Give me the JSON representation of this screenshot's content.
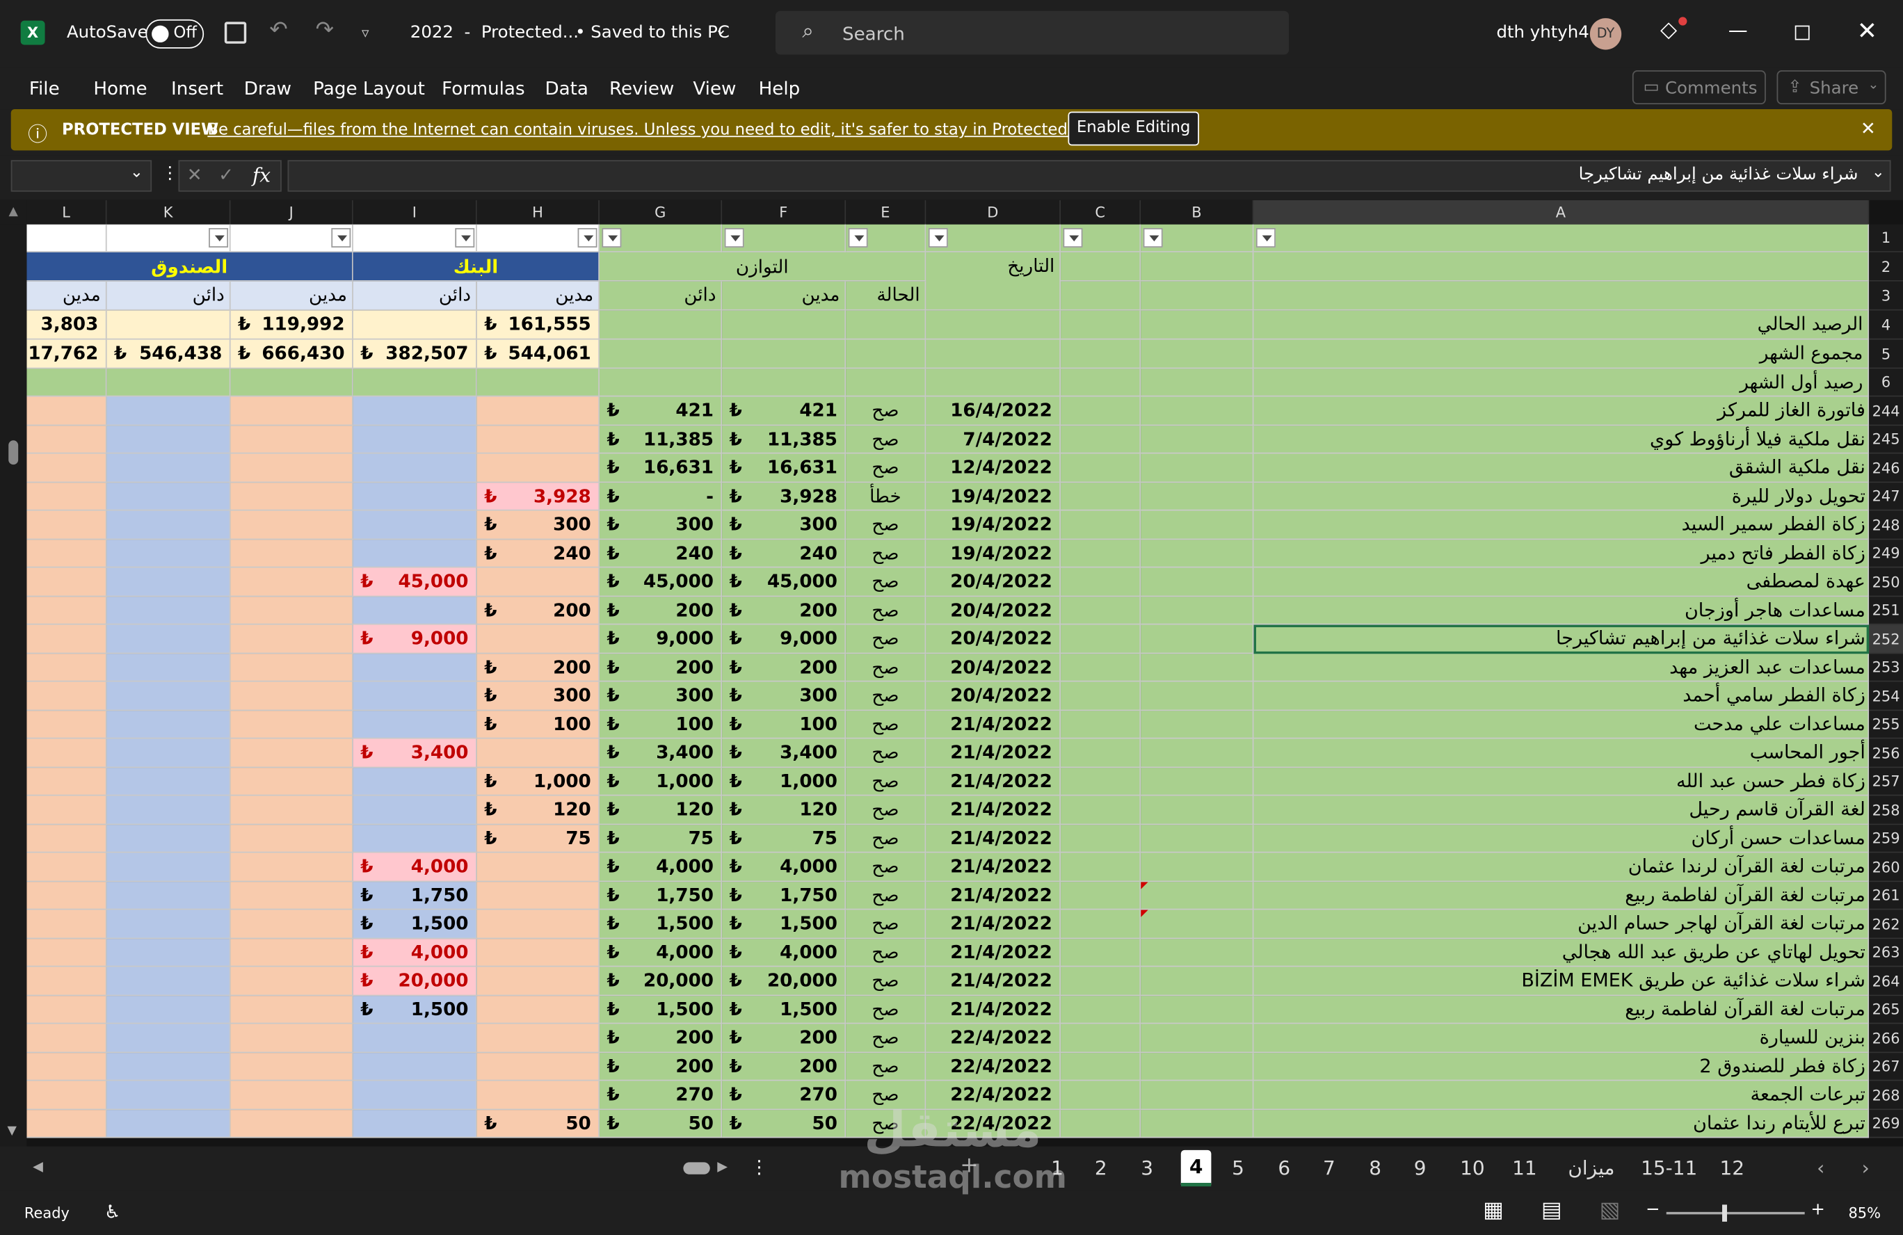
{
  "titlebar": {
    "autosave_label": "AutoSave",
    "toggle_label": "Off",
    "file_name": "2022  -  Protected...",
    "saved_status": "• Saved to this PC",
    "search_placeholder": "Search",
    "user_name": "dth yhtyh4",
    "avatar_initials": "DY"
  },
  "menu": [
    "File",
    "Home",
    "Insert",
    "Draw",
    "Page Layout",
    "Formulas",
    "Data",
    "Review",
    "View",
    "Help"
  ],
  "comments_label": "Comments",
  "share_label": "Share",
  "protected": {
    "title": "PROTECTED VIEW",
    "message": "Be careful—files from the Internet can contain viruses. Unless you need to edit, it's safer to stay in Protected View.",
    "button": "Enable Editing"
  },
  "formula": {
    "fx": "fx",
    "content": "شراء سلات غذائية من إبراهيم تشاكيرجا"
  },
  "columns": [
    "L",
    "K",
    "J",
    "I",
    "H",
    "G",
    "F",
    "E",
    "D",
    "C",
    "B",
    "A"
  ],
  "headers": {
    "bank": "البنك",
    "cash": "الصندوق",
    "balance": "التوازن",
    "date": "التاريخ",
    "status": "الحالة",
    "debit": "مدين",
    "credit": "دائن"
  },
  "summary": {
    "labels": [
      "الرصيد الحالي",
      "مجموع الشهر",
      "رصيد أول الشهر"
    ],
    "row4": {
      "L": "3,803",
      "J": "119,992",
      "H": "161,555"
    },
    "row5": {
      "L": "17,762",
      "K": "546,438",
      "J": "666,430",
      "I": "382,507",
      "H": "544,061"
    }
  },
  "currency": "₺",
  "rows": [
    {
      "n": "244",
      "a": "فاتورة الغاز للمركز",
      "d": "16/4/2022",
      "e": "صح",
      "f": "421",
      "g": "421"
    },
    {
      "n": "245",
      "a": "نقل ملكية فيلا أرناؤوط كوي",
      "d": "7/4/2022",
      "e": "صح",
      "f": "11,385",
      "g": "11,385"
    },
    {
      "n": "246",
      "a": "نقل ملكية الشقق",
      "d": "12/4/2022",
      "e": "صح",
      "f": "16,631",
      "g": "16,631"
    },
    {
      "n": "247",
      "a": "تحويل دولار لليرة",
      "d": "19/4/2022",
      "e": "خطأ",
      "f": "3,928",
      "g": "-",
      "h": "3,928",
      "hred": true
    },
    {
      "n": "248",
      "a": "زكاة الفطر  سمير السيد",
      "d": "19/4/2022",
      "e": "صح",
      "f": "300",
      "g": "300",
      "h": "300"
    },
    {
      "n": "249",
      "a": "زكاة الفطر فاتح دمير",
      "d": "19/4/2022",
      "e": "صح",
      "f": "240",
      "g": "240",
      "h": "240"
    },
    {
      "n": "250",
      "a": "عهدة لمصطفى",
      "d": "20/4/2022",
      "e": "صح",
      "f": "45,000",
      "g": "45,000",
      "i": "45,000",
      "ired": true
    },
    {
      "n": "251",
      "a": "مساعدات هاجر أوزجان",
      "d": "20/4/2022",
      "e": "صح",
      "f": "200",
      "g": "200",
      "h": "200"
    },
    {
      "n": "252",
      "a": "شراء سلات غذائية من إبراهيم تشاكيرجا",
      "d": "20/4/2022",
      "e": "صح",
      "f": "9,000",
      "g": "9,000",
      "i": "9,000",
      "ired": true
    },
    {
      "n": "253",
      "a": "مساعدات عبد العزيز مهد",
      "d": "20/4/2022",
      "e": "صح",
      "f": "200",
      "g": "200",
      "h": "200"
    },
    {
      "n": "254",
      "a": "زكاة الفطر سامي أحمد",
      "d": "20/4/2022",
      "e": "صح",
      "f": "300",
      "g": "300",
      "h": "300"
    },
    {
      "n": "255",
      "a": "مساعدات علي مدحت",
      "d": "21/4/2022",
      "e": "صح",
      "f": "100",
      "g": "100",
      "h": "100"
    },
    {
      "n": "256",
      "a": "أجور المحاسب",
      "d": "21/4/2022",
      "e": "صح",
      "f": "3,400",
      "g": "3,400",
      "i": "3,400",
      "ired": true
    },
    {
      "n": "257",
      "a": "زكاة فطر حسن عبد الله",
      "d": "21/4/2022",
      "e": "صح",
      "f": "1,000",
      "g": "1,000",
      "h": "1,000"
    },
    {
      "n": "258",
      "a": "لغة القرآن قاسم رحيل",
      "d": "21/4/2022",
      "e": "صح",
      "f": "120",
      "g": "120",
      "h": "120"
    },
    {
      "n": "259",
      "a": "مساعدات حسن أركان",
      "d": "21/4/2022",
      "e": "صح",
      "f": "75",
      "g": "75",
      "h": "75"
    },
    {
      "n": "260",
      "a": "مرتبات لغة القرآن لرندا عثمان",
      "d": "21/4/2022",
      "e": "صح",
      "f": "4,000",
      "g": "4,000",
      "i": "4,000",
      "ired": true
    },
    {
      "n": "261",
      "a": "مرتبات لغة القرآن لفاطمة ربيع",
      "d": "21/4/2022",
      "e": "صح",
      "f": "1,750",
      "g": "1,750",
      "i": "1,750"
    },
    {
      "n": "262",
      "a": "مرتبات لغة القرآن لهاجر حسام الدين",
      "d": "21/4/2022",
      "e": "صح",
      "f": "1,500",
      "g": "1,500",
      "i": "1,500"
    },
    {
      "n": "263",
      "a": "تحويل لهاتاي عن طريق عبد الله هجالي",
      "d": "21/4/2022",
      "e": "صح",
      "f": "4,000",
      "g": "4,000",
      "i": "4,000",
      "ired": true
    },
    {
      "n": "264",
      "a": "شراء سلات غذائية عن طريق BİZİM EMEK",
      "d": "21/4/2022",
      "e": "صح",
      "f": "20,000",
      "g": "20,000",
      "i": "20,000",
      "ired": true
    },
    {
      "n": "265",
      "a": "مرتبات لغة القرآن لفاطمة ربيع",
      "d": "21/4/2022",
      "e": "صح",
      "f": "1,500",
      "g": "1,500",
      "i": "1,500"
    },
    {
      "n": "266",
      "a": "بنزين للسيارة",
      "d": "22/4/2022",
      "e": "صح",
      "f": "200",
      "g": "200"
    },
    {
      "n": "267",
      "a": "زكاة فطر للصندوق 2",
      "d": "22/4/2022",
      "e": "صح",
      "f": "200",
      "g": "200"
    },
    {
      "n": "268",
      "a": "تبرعات الجمعة",
      "d": "22/4/2022",
      "e": "صح",
      "f": "270",
      "g": "270"
    },
    {
      "n": "269",
      "a": "تبرع للأيتام رندا عثمان",
      "d": "22/4/2022",
      "e": "صح",
      "f": "50",
      "g": "50",
      "h": "50"
    }
  ],
  "tabs": [
    "1",
    "2",
    "3",
    "4",
    "5",
    "6",
    "7",
    "8",
    "9",
    "10",
    "11",
    "ميزان",
    "15-11",
    "12"
  ],
  "active_tab": "4",
  "status": {
    "ready": "Ready",
    "zoom": "85%"
  },
  "watermark": {
    "arabic": "مستقل",
    "latin": "mostaql.com"
  },
  "colors": {
    "green": "#a9d08e",
    "peach": "#f8cbad",
    "blue": "#b4c6e7",
    "navy": "#2f5496",
    "yellow": "#ffff00",
    "cream": "#fff2cc",
    "lightblue": "#dae3f3",
    "pink": "#ffc7ce",
    "red": "#c00000",
    "banner": "#7a6300"
  }
}
